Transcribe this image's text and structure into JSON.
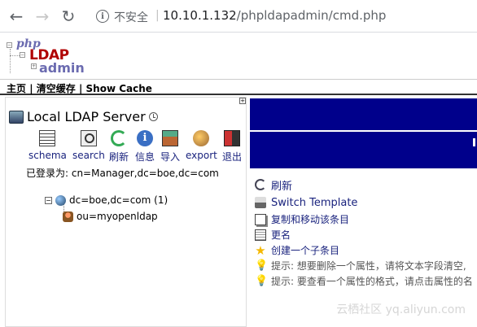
{
  "browser": {
    "back_glyph": "←",
    "forward_glyph": "→",
    "reload_glyph": "↻",
    "info_glyph": "i",
    "insecure_label": "不安全",
    "separator": "|",
    "url_host": "10.10.1.132",
    "url_path": "/phpldapadmin/cmd.php"
  },
  "logo": {
    "line1": "php",
    "line2": "LDAP",
    "line3": "admin"
  },
  "topmenu": {
    "home": "主页",
    "sep1": " | ",
    "clear_cache": "清空缓存",
    "sep2": " | ",
    "show_cache": "Show Cache"
  },
  "server": {
    "title": "Local LDAP Server",
    "tools": [
      {
        "label": "schema",
        "icon": "schema-icon"
      },
      {
        "label": "search",
        "icon": "search-icon"
      },
      {
        "label": "刷新",
        "icon": "refresh-icon"
      },
      {
        "label": "信息",
        "icon": "info-icon"
      },
      {
        "label": "导入",
        "icon": "import-icon"
      },
      {
        "label": "export",
        "icon": "export-icon"
      },
      {
        "label": "退出",
        "icon": "logout-icon"
      }
    ],
    "logged_in": "已登录为: cn=Manager,dc=boe,dc=com",
    "tree": {
      "root": "dc=boe,dc=com (1)",
      "child": "ou=myopenldap"
    }
  },
  "actions": {
    "refresh": "刷新",
    "switch_template": "Switch Template",
    "copy_move": "复制和移动该条目",
    "rename": "更名",
    "create_child": "创建一个子条目",
    "hint1": "提示:  想要删除一个属性，请将文本字段清空,",
    "hint2": "提示:  要查看一个属性的格式，请点击属性的名"
  },
  "watermark": "云栖社区 yq.aliyun.com",
  "colors": {
    "banner": "#00008b",
    "link": "#1a237e"
  }
}
